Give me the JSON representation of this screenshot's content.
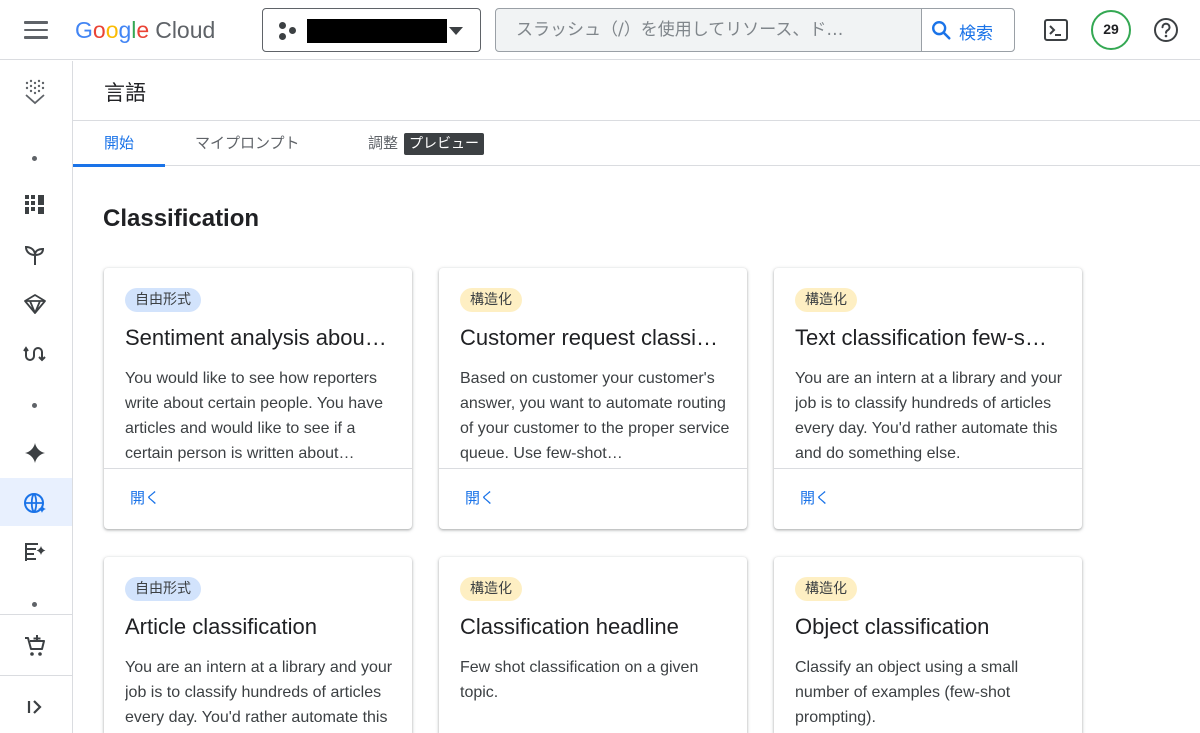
{
  "app": {
    "logo": {
      "google": [
        "G",
        "o",
        "o",
        "g",
        "l",
        "e"
      ],
      "cloud": "Cloud"
    },
    "search": {
      "placeholder": "スラッシュ（/）を使用してリソース、ド…",
      "button_label": "検索"
    },
    "notifications_count": "29"
  },
  "page": {
    "title": "言語"
  },
  "tabs": [
    {
      "label": "開始",
      "active": true
    },
    {
      "label": "マイプロンプト",
      "active": false
    },
    {
      "label": "調整",
      "badge": "プレビュー",
      "active": false
    }
  ],
  "section": {
    "title": "Classification"
  },
  "cards": [
    {
      "chip": "自由形式",
      "chip_type": "free",
      "title": "Sentiment analysis abou…",
      "description": "You would like to see how reporters write about certain people. You have articles and would like to see if a certain person is written about…",
      "action": "開く"
    },
    {
      "chip": "構造化",
      "chip_type": "struct",
      "title": "Customer request classi…",
      "description": "Based on customer your customer's answer, you want to automate routing of your customer to the proper service queue. Use few-shot…",
      "action": "開く"
    },
    {
      "chip": "構造化",
      "chip_type": "struct",
      "title": "Text classification few-s…",
      "description": "You are an intern at a library and your job is to classify hundreds of articles every day. You'd rather automate this and do something else.",
      "action": "開く"
    },
    {
      "chip": "自由形式",
      "chip_type": "free",
      "title": "Article classification",
      "description": "You are an intern at a library and your job is to classify hundreds of articles every day. You'd rather automate this",
      "action": ""
    },
    {
      "chip": "構造化",
      "chip_type": "struct",
      "title": "Classification headline",
      "description": "Few shot classification on a given topic.",
      "action": ""
    },
    {
      "chip": "構造化",
      "chip_type": "struct",
      "title": "Object classification",
      "description": "Classify an object using a small number of examples (few-shot prompting).",
      "action": ""
    }
  ],
  "rail_icons": [
    "vertex-ai-logo-icon",
    "dashboard-icon",
    "sprout-icon",
    "model-garden-icon",
    "pipelines-icon",
    "sparkle-icon",
    "language-globe-icon",
    "document-sparkle-icon",
    "marketplace-icon",
    "expand-rail-icon"
  ],
  "colors": {
    "accent": "#1a73e8",
    "free_chip": "#d2e3fc",
    "struct_chip": "#feefc3",
    "badge_ring": "#34a853"
  }
}
